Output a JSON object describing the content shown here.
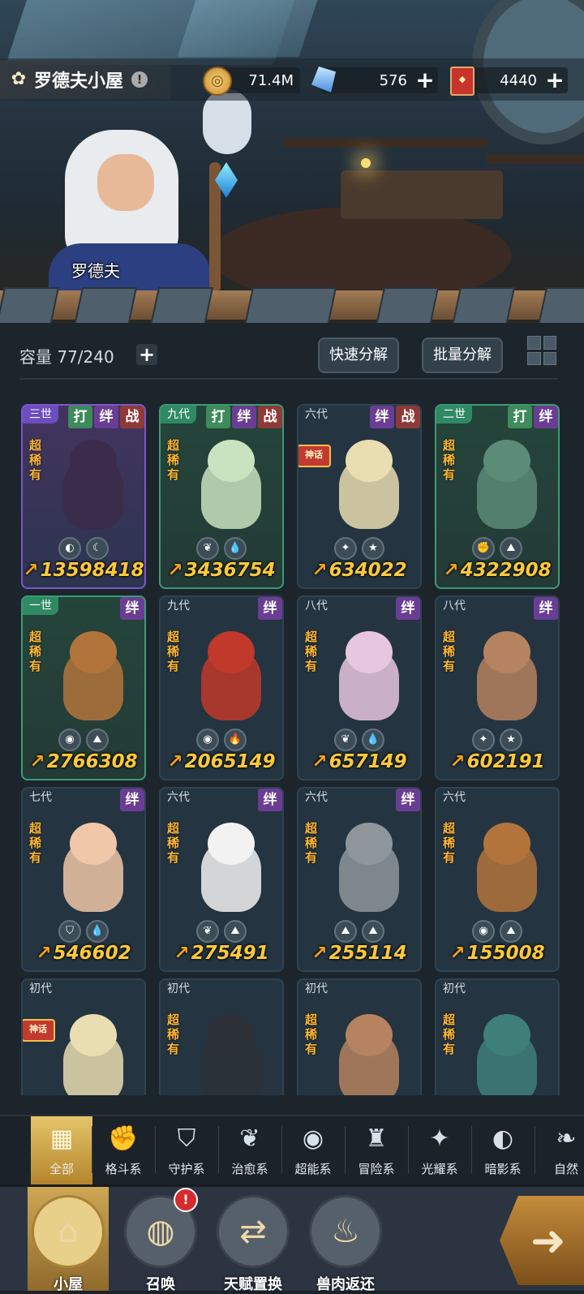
{
  "header": {
    "location_title": "罗德夫小屋",
    "npc_name": "罗德夫",
    "resources": [
      {
        "icon": "gold-coin-icon",
        "value": "71.4M"
      },
      {
        "icon": "crystal-icon",
        "value": "576",
        "plus": "+"
      },
      {
        "icon": "ticket-icon",
        "value": "4440",
        "plus": "+"
      }
    ]
  },
  "capacity": {
    "label": "容量 77/240",
    "plus": "+"
  },
  "actions": {
    "quick_decompose": "快速分解",
    "batch_decompose": "批量分解"
  },
  "cards": [
    {
      "gen": "三世",
      "style": "purple",
      "tags": [
        "打",
        "绊",
        "战"
      ],
      "rarity": "超稀有",
      "elements": [
        "shadow",
        "dark-moon"
      ],
      "power": "13598418",
      "color": "#3c2b4a"
    },
    {
      "gen": "九代",
      "style": "green",
      "tags": [
        "打",
        "绊",
        "战"
      ],
      "rarity": "超稀有",
      "elements": [
        "heal",
        "water"
      ],
      "power": "3436754",
      "color": "#c9e2c0"
    },
    {
      "gen": "六代",
      "style": "plain",
      "tags": [
        "绊",
        "战"
      ],
      "badge": "神话",
      "elements": [
        "light",
        "star"
      ],
      "power": "634022",
      "color": "#e9ddb2"
    },
    {
      "gen": "二世",
      "style": "green",
      "tags": [
        "打",
        "绊"
      ],
      "rarity": "超稀有",
      "elements": [
        "fight",
        "adventure"
      ],
      "power": "4322908",
      "color": "#5c8c78"
    },
    {
      "gen": "一世",
      "style": "green",
      "tags": [
        "绊"
      ],
      "rarity": "超稀有",
      "elements": [
        "psychic",
        "adventure"
      ],
      "power": "2766308",
      "color": "#b3743c"
    },
    {
      "gen": "九代",
      "style": "plain",
      "tags": [
        "绊"
      ],
      "rarity": "超稀有",
      "elements": [
        "psychic",
        "fire"
      ],
      "power": "2065149",
      "color": "#c0392b"
    },
    {
      "gen": "八代",
      "style": "plain",
      "tags": [
        "绊"
      ],
      "rarity": "超稀有",
      "elements": [
        "heal",
        "water"
      ],
      "power": "657149",
      "color": "#e7c6e0"
    },
    {
      "gen": "八代",
      "style": "plain",
      "tags": [
        "绊"
      ],
      "rarity": "超稀有",
      "elements": [
        "light",
        "star"
      ],
      "power": "602191",
      "color": "#b5835f"
    },
    {
      "gen": "七代",
      "style": "plain",
      "tags": [
        "绊"
      ],
      "rarity": "超稀有",
      "elements": [
        "guard",
        "water"
      ],
      "power": "546602",
      "color": "#f0c7a8"
    },
    {
      "gen": "六代",
      "style": "plain",
      "tags": [
        "绊"
      ],
      "rarity": "超稀有",
      "elements": [
        "heal",
        "adventure"
      ],
      "power": "275491",
      "color": "#f2f2f2"
    },
    {
      "gen": "六代",
      "style": "plain",
      "tags": [
        "绊"
      ],
      "rarity": "超稀有",
      "elements": [
        "adventure",
        "adventure"
      ],
      "power": "255114",
      "color": "#8e969c"
    },
    {
      "gen": "六代",
      "style": "plain",
      "tags": [],
      "rarity": "超稀有",
      "elements": [
        "psychic",
        "adventure"
      ],
      "power": "155008",
      "color": "#b3743c"
    },
    {
      "gen": "初代",
      "style": "plain",
      "tags": [],
      "badge": "神话",
      "elements": [],
      "power": "",
      "color": "#e9ddb2"
    },
    {
      "gen": "初代",
      "style": "plain",
      "tags": [],
      "rarity": "超稀有",
      "elements": [],
      "power": "",
      "color": "#2b3136"
    },
    {
      "gen": "初代",
      "style": "plain",
      "tags": [],
      "rarity": "超稀有",
      "elements": [],
      "power": "",
      "color": "#b5835f"
    },
    {
      "gen": "初代",
      "style": "plain",
      "tags": [],
      "rarity": "超稀有",
      "elements": [],
      "power": "",
      "color": "#3e7f7a"
    }
  ],
  "filters": [
    {
      "label": "全部",
      "icon": "all-blocks-icon",
      "glyph": "▦",
      "active": true
    },
    {
      "label": "格斗系",
      "icon": "fist-icon",
      "glyph": "✊"
    },
    {
      "label": "守护系",
      "icon": "shield-icon",
      "glyph": "⛉"
    },
    {
      "label": "治愈系",
      "icon": "sprout-icon",
      "glyph": "❦"
    },
    {
      "label": "超能系",
      "icon": "alien-head-icon",
      "glyph": "◉"
    },
    {
      "label": "冒险系",
      "icon": "lantern-icon",
      "glyph": "♜"
    },
    {
      "label": "光耀系",
      "icon": "sparkle-icon",
      "glyph": "✦"
    },
    {
      "label": "暗影系",
      "icon": "eclipse-icon",
      "glyph": "◐"
    },
    {
      "label": "自然",
      "icon": "leaf-icon",
      "glyph": "❧"
    }
  ],
  "nav": [
    {
      "label": "小屋",
      "icon": "cabin-icon",
      "glyph": "⌂",
      "active": true
    },
    {
      "label": "召唤",
      "icon": "egg-icon",
      "glyph": "◍",
      "alert": "!"
    },
    {
      "label": "天赋置换",
      "icon": "swap-arrows-icon",
      "glyph": "⇄"
    },
    {
      "label": "兽肉返还",
      "icon": "meat-icon",
      "glyph": "♨"
    }
  ]
}
